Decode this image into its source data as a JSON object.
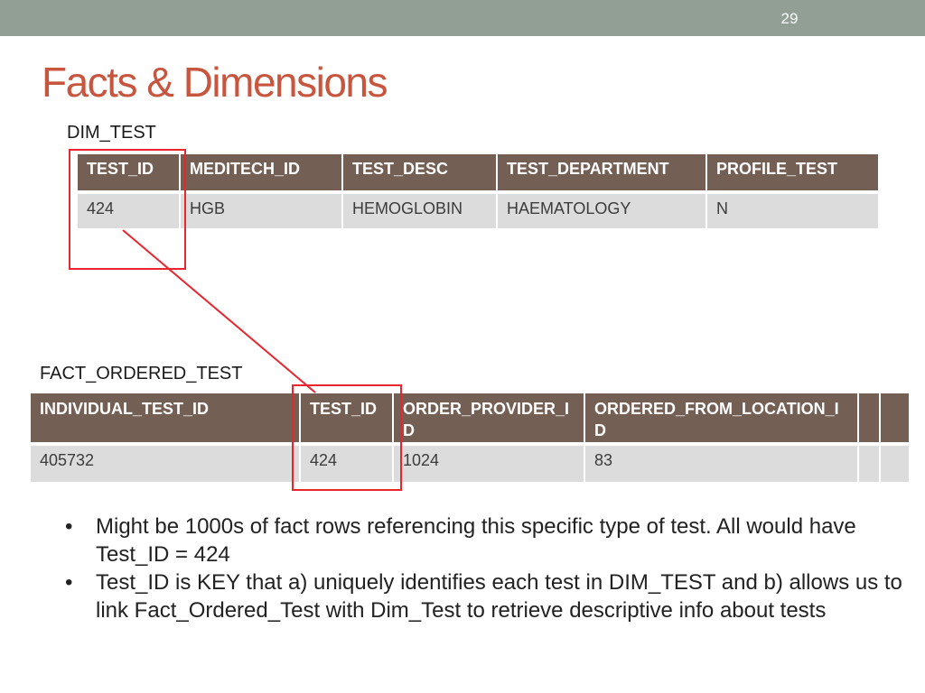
{
  "slide": {
    "page_number": "29",
    "title": "Facts & Dimensions"
  },
  "dim_test": {
    "label": "DIM_TEST",
    "columns": [
      "TEST_ID",
      "MEDITECH_ID",
      "TEST_DESC",
      "TEST_DEPARTMENT",
      "PROFILE_TEST"
    ],
    "row": [
      "424",
      "HGB",
      "HEMOGLOBIN",
      "HAEMATOLOGY",
      "N"
    ]
  },
  "fact_ordered_test": {
    "label": "FACT_ORDERED_TEST",
    "columns": [
      "INDIVIDUAL_TEST_ID",
      "TEST_ID",
      "ORDER_PROVIDER_ID",
      "ORDERED_FROM_LOCATION_ID",
      "",
      ""
    ],
    "row": [
      "405732",
      "424",
      "1024",
      "83",
      "",
      ""
    ]
  },
  "bullets": [
    "Might be 1000s of fact rows referencing this specific type of test.  All would have Test_ID = 424",
    "Test_ID is KEY that a) uniquely identifies each test in DIM_TEST and b) allows us to link Fact_Ordered_Test with Dim_Test to retrieve descriptive info about tests"
  ],
  "colors": {
    "topbar": "#919f94",
    "title": "#c8553d",
    "header_bg": "#735f54",
    "cell_bg": "#dcdcdc",
    "highlight": "#e8262e"
  }
}
